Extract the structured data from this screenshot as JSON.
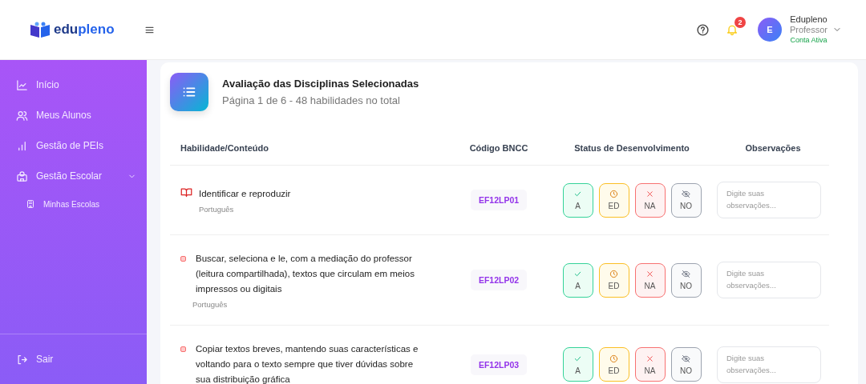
{
  "brand": [
    "edu",
    "pleno"
  ],
  "header": {
    "notifications": "2",
    "user": {
      "avatar": "E",
      "name": "Edupleno",
      "role": "Professor",
      "status": "Conta Ativa"
    }
  },
  "sidebar": {
    "items": [
      {
        "label": "Início"
      },
      {
        "label": "Meus Alunos"
      },
      {
        "label": "Gestão de PEIs"
      },
      {
        "label": "Gestão Escolar",
        "expanded": true,
        "children": [
          {
            "label": "Minhas Escolas"
          }
        ]
      }
    ],
    "logout": "Sair"
  },
  "card": {
    "title": "Avaliação das Disciplinas Selecionadas",
    "subtitle": "Página 1 de 6 - 48 habilidades no total",
    "columns": [
      "Habilidade/Conteúdo",
      "Código BNCC",
      "Status de Desenvolvimento",
      "Observações"
    ],
    "rows": [
      {
        "kind": "book",
        "skill": "Identificar e reproduzir",
        "subject": "Português",
        "code": "EF12LP01",
        "placeholder": "Digite suas observações...",
        "statuses": [
          {
            "kind": "check",
            "label": "A",
            "selected": false
          },
          {
            "kind": "clock",
            "label": "ED",
            "selected": false
          },
          {
            "kind": "x",
            "label": "NA",
            "selected": false
          },
          {
            "kind": "eye",
            "label": "NO",
            "selected": false
          }
        ]
      },
      {
        "kind": "dot",
        "skill": "Buscar, seleciona e le, com a mediação do professor (leitura compartilhada), textos que circulam em meios impressos ou digitais",
        "subject": "Português",
        "code": "EF12LP02",
        "placeholder": "Digite suas observações...",
        "statuses": [
          {
            "kind": "check",
            "label": "A",
            "selected": false
          },
          {
            "kind": "clock",
            "label": "ED",
            "selected": false
          },
          {
            "kind": "x",
            "label": "NA",
            "selected": false
          },
          {
            "kind": "eye",
            "label": "NO",
            "selected": false
          }
        ]
      },
      {
        "kind": "dot",
        "skill": "Copiar textos breves, mantendo suas características e voltando para o texto sempre que tiver dúvidas sobre sua distribuição gráfica",
        "code": "EF12LP03",
        "placeholder": "Digite suas observações...",
        "statuses": [
          {
            "kind": "check",
            "label": "A",
            "selected": false
          },
          {
            "kind": "clock",
            "label": "ED",
            "selected": false
          },
          {
            "kind": "x",
            "label": "NA",
            "selected": false
          },
          {
            "kind": "eye",
            "label": "NO",
            "selected": false
          }
        ]
      }
    ]
  }
}
